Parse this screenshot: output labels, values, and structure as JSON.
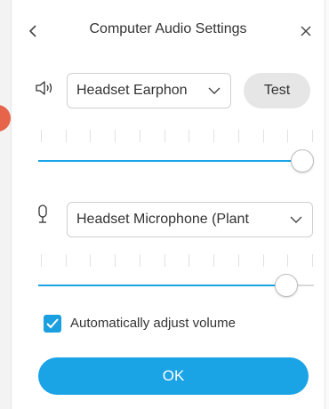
{
  "header": {
    "title": "Computer Audio Settings"
  },
  "speaker": {
    "device": "Headset Earphon",
    "test_label": "Test",
    "volume": 1.0,
    "tick_count": 12
  },
  "microphone": {
    "device": "Headset Microphone (Plant",
    "volume": 0.9,
    "tick_count": 12
  },
  "auto_adjust": {
    "label": "Automatically adjust volume",
    "checked": true
  },
  "ok_label": "OK",
  "colors": {
    "accent": "#1aa3e5",
    "test_button_bg": "#e6e6e6"
  },
  "icons": [
    "back-icon",
    "close-icon",
    "speaker-icon",
    "microphone-icon",
    "chevron-down-icon",
    "checkmark-icon"
  ]
}
